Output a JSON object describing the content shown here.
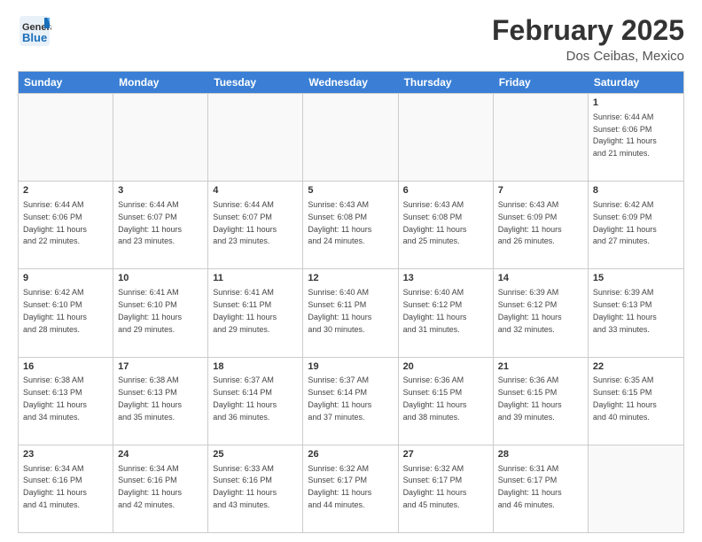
{
  "header": {
    "logo_general": "General",
    "logo_blue": "Blue",
    "title": "February 2025",
    "subtitle": "Dos Ceibas, Mexico"
  },
  "weekdays": [
    "Sunday",
    "Monday",
    "Tuesday",
    "Wednesday",
    "Thursday",
    "Friday",
    "Saturday"
  ],
  "rows": [
    [
      {
        "day": "",
        "info": ""
      },
      {
        "day": "",
        "info": ""
      },
      {
        "day": "",
        "info": ""
      },
      {
        "day": "",
        "info": ""
      },
      {
        "day": "",
        "info": ""
      },
      {
        "day": "",
        "info": ""
      },
      {
        "day": "1",
        "info": "Sunrise: 6:44 AM\nSunset: 6:06 PM\nDaylight: 11 hours\nand 21 minutes."
      }
    ],
    [
      {
        "day": "2",
        "info": "Sunrise: 6:44 AM\nSunset: 6:06 PM\nDaylight: 11 hours\nand 22 minutes."
      },
      {
        "day": "3",
        "info": "Sunrise: 6:44 AM\nSunset: 6:07 PM\nDaylight: 11 hours\nand 23 minutes."
      },
      {
        "day": "4",
        "info": "Sunrise: 6:44 AM\nSunset: 6:07 PM\nDaylight: 11 hours\nand 23 minutes."
      },
      {
        "day": "5",
        "info": "Sunrise: 6:43 AM\nSunset: 6:08 PM\nDaylight: 11 hours\nand 24 minutes."
      },
      {
        "day": "6",
        "info": "Sunrise: 6:43 AM\nSunset: 6:08 PM\nDaylight: 11 hours\nand 25 minutes."
      },
      {
        "day": "7",
        "info": "Sunrise: 6:43 AM\nSunset: 6:09 PM\nDaylight: 11 hours\nand 26 minutes."
      },
      {
        "day": "8",
        "info": "Sunrise: 6:42 AM\nSunset: 6:09 PM\nDaylight: 11 hours\nand 27 minutes."
      }
    ],
    [
      {
        "day": "9",
        "info": "Sunrise: 6:42 AM\nSunset: 6:10 PM\nDaylight: 11 hours\nand 28 minutes."
      },
      {
        "day": "10",
        "info": "Sunrise: 6:41 AM\nSunset: 6:10 PM\nDaylight: 11 hours\nand 29 minutes."
      },
      {
        "day": "11",
        "info": "Sunrise: 6:41 AM\nSunset: 6:11 PM\nDaylight: 11 hours\nand 29 minutes."
      },
      {
        "day": "12",
        "info": "Sunrise: 6:40 AM\nSunset: 6:11 PM\nDaylight: 11 hours\nand 30 minutes."
      },
      {
        "day": "13",
        "info": "Sunrise: 6:40 AM\nSunset: 6:12 PM\nDaylight: 11 hours\nand 31 minutes."
      },
      {
        "day": "14",
        "info": "Sunrise: 6:39 AM\nSunset: 6:12 PM\nDaylight: 11 hours\nand 32 minutes."
      },
      {
        "day": "15",
        "info": "Sunrise: 6:39 AM\nSunset: 6:13 PM\nDaylight: 11 hours\nand 33 minutes."
      }
    ],
    [
      {
        "day": "16",
        "info": "Sunrise: 6:38 AM\nSunset: 6:13 PM\nDaylight: 11 hours\nand 34 minutes."
      },
      {
        "day": "17",
        "info": "Sunrise: 6:38 AM\nSunset: 6:13 PM\nDaylight: 11 hours\nand 35 minutes."
      },
      {
        "day": "18",
        "info": "Sunrise: 6:37 AM\nSunset: 6:14 PM\nDaylight: 11 hours\nand 36 minutes."
      },
      {
        "day": "19",
        "info": "Sunrise: 6:37 AM\nSunset: 6:14 PM\nDaylight: 11 hours\nand 37 minutes."
      },
      {
        "day": "20",
        "info": "Sunrise: 6:36 AM\nSunset: 6:15 PM\nDaylight: 11 hours\nand 38 minutes."
      },
      {
        "day": "21",
        "info": "Sunrise: 6:36 AM\nSunset: 6:15 PM\nDaylight: 11 hours\nand 39 minutes."
      },
      {
        "day": "22",
        "info": "Sunrise: 6:35 AM\nSunset: 6:15 PM\nDaylight: 11 hours\nand 40 minutes."
      }
    ],
    [
      {
        "day": "23",
        "info": "Sunrise: 6:34 AM\nSunset: 6:16 PM\nDaylight: 11 hours\nand 41 minutes."
      },
      {
        "day": "24",
        "info": "Sunrise: 6:34 AM\nSunset: 6:16 PM\nDaylight: 11 hours\nand 42 minutes."
      },
      {
        "day": "25",
        "info": "Sunrise: 6:33 AM\nSunset: 6:16 PM\nDaylight: 11 hours\nand 43 minutes."
      },
      {
        "day": "26",
        "info": "Sunrise: 6:32 AM\nSunset: 6:17 PM\nDaylight: 11 hours\nand 44 minutes."
      },
      {
        "day": "27",
        "info": "Sunrise: 6:32 AM\nSunset: 6:17 PM\nDaylight: 11 hours\nand 45 minutes."
      },
      {
        "day": "28",
        "info": "Sunrise: 6:31 AM\nSunset: 6:17 PM\nDaylight: 11 hours\nand 46 minutes."
      },
      {
        "day": "",
        "info": ""
      }
    ]
  ]
}
